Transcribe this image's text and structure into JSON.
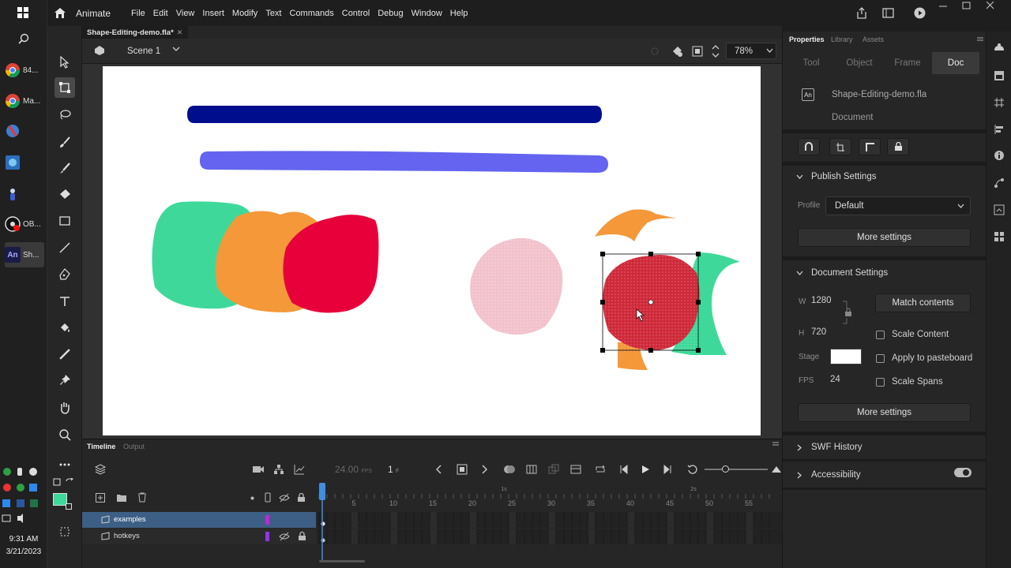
{
  "app": {
    "name": "Animate"
  },
  "menu": [
    "File",
    "Edit",
    "View",
    "Insert",
    "Modify",
    "Text",
    "Commands",
    "Control",
    "Debug",
    "Window",
    "Help"
  ],
  "taskbar": {
    "apps": [
      {
        "label": "84...",
        "icon": "chrome-icon"
      },
      {
        "label": "Ma...",
        "icon": "chrome-icon"
      },
      {
        "label": "",
        "icon": "app-icon"
      },
      {
        "label": "",
        "icon": "app-icon"
      },
      {
        "label": "",
        "icon": "app-icon"
      },
      {
        "label": "OB...",
        "icon": "obs-icon"
      },
      {
        "label": "Sh...",
        "icon": "animate-icon"
      }
    ],
    "time": "9:31 AM",
    "date": "3/21/2023"
  },
  "document": {
    "tab_title": "Shape-Editing-demo.fla*",
    "scene": "Scene 1",
    "zoom": "78%"
  },
  "timeline": {
    "tabs": [
      "Timeline",
      "Output"
    ],
    "fps": "24.00",
    "fps_unit": "FPS",
    "frame": "1",
    "frame_unit": "F",
    "ruler": [
      "5",
      "10",
      "15",
      "20",
      "25",
      "30",
      "35",
      "40",
      "45",
      "50",
      "55"
    ],
    "seconds": [
      "1s",
      "2s"
    ],
    "layers": [
      {
        "name": "examples",
        "color": "#c026d3",
        "selected": true
      },
      {
        "name": "hotkeys",
        "color": "#9333ea",
        "selected": false
      }
    ]
  },
  "properties": {
    "panel_tabs": [
      "Properties",
      "Library",
      "Assets"
    ],
    "tabs": [
      "Tool",
      "Object",
      "Frame",
      "Doc"
    ],
    "active_tab": "Doc",
    "doc_icon_label": "An",
    "filename": "Shape-Editing-demo.fla",
    "type": "Document",
    "publish": {
      "title": "Publish Settings",
      "profile_label": "Profile",
      "profile_value": "Default",
      "more": "More settings"
    },
    "docsettings": {
      "title": "Document Settings",
      "w_label": "W",
      "w_value": "1280",
      "h_label": "H",
      "h_value": "720",
      "match": "Match contents",
      "scale_content": "Scale Content",
      "stage_label": "Stage",
      "stage_color": "#ffffff",
      "apply_pasteboard": "Apply to pasteboard",
      "fps_label": "FPS",
      "fps_value": "24",
      "scale_spans": "Scale Spans",
      "more": "More settings"
    },
    "swf": "SWF History",
    "accessibility": "Accessibility"
  },
  "colors": {
    "dark_blue": "#000d8c",
    "purple_blue": "#6464f0",
    "green": "#3ed99a",
    "orange": "#f4983a",
    "red": "#e8003a",
    "pink": "#f2c2cc",
    "selected_red": "#cf2a3a",
    "fill_swatch": "#3ed99a"
  }
}
